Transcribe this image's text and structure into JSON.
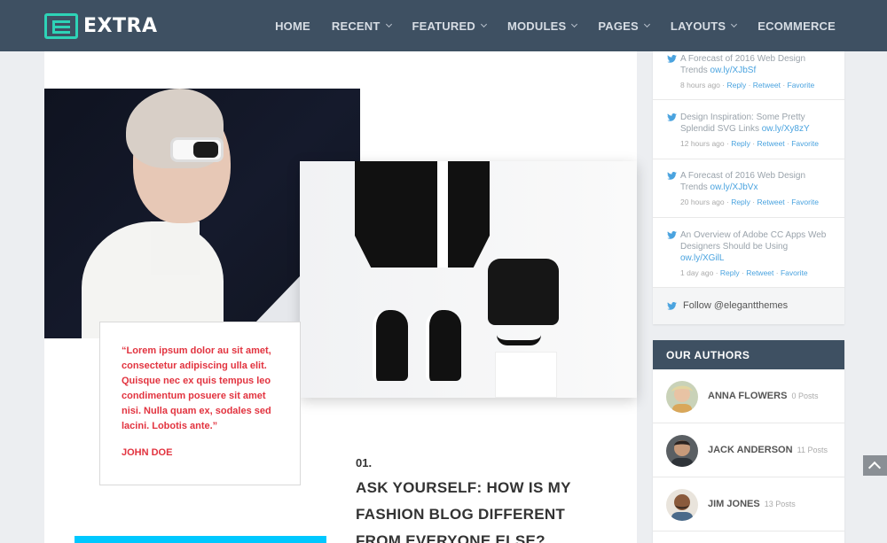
{
  "brand": {
    "name": "EXTRA",
    "accent": "#2ed3b7"
  },
  "nav": {
    "items": [
      {
        "label": "HOME",
        "dropdown": false
      },
      {
        "label": "RECENT",
        "dropdown": true
      },
      {
        "label": "FEATURED",
        "dropdown": true
      },
      {
        "label": "MODULES",
        "dropdown": true
      },
      {
        "label": "PAGES",
        "dropdown": true
      },
      {
        "label": "LAYOUTS",
        "dropdown": true
      },
      {
        "label": "ECOMMERCE",
        "dropdown": false
      }
    ]
  },
  "quote": {
    "text": "“Lorem ipsum dolor au sit amet, consectetur adipiscing ulla elit. Quisque nec ex quis tempus leo condimentum posuere sit amet nisi. Nulla quam ex, sodales sed lacini. Lobotis ante.”",
    "author": "JOHN DOE",
    "color": "#e2333f"
  },
  "post": {
    "number": "01.",
    "title": "ASK YOURSELF: HOW IS MY FASHION BLOG DIFFERENT FROM EVERYONE ELSE?"
  },
  "twitter": {
    "tweets": [
      {
        "text": "A Forecast of 2016 Web Design Trends",
        "link": "ow.ly/XJbSf",
        "time": "8 hours ago",
        "actions": [
          "Reply",
          "Retweet",
          "Favorite"
        ]
      },
      {
        "text": "Design Inspiration: Some Pretty Splendid SVG Links",
        "link": "ow.ly/Xy8zY",
        "time": "12 hours ago",
        "actions": [
          "Reply",
          "Retweet",
          "Favorite"
        ]
      },
      {
        "text": "A Forecast of 2016 Web Design Trends",
        "link": "ow.ly/XJbVx",
        "time": "20 hours ago",
        "actions": [
          "Reply",
          "Retweet",
          "Favorite"
        ]
      },
      {
        "text": "An Overview of Adobe CC Apps Web Designers Should be Using",
        "link": "ow.ly/XGilL",
        "time": "1 day ago",
        "actions": [
          "Reply",
          "Retweet",
          "Favorite"
        ]
      }
    ],
    "follow_label": "Follow @elegantthemes",
    "icon_color": "#4aa3df"
  },
  "authors": {
    "heading": "OUR AUTHORS",
    "list": [
      {
        "name": "ANNA FLOWERS",
        "posts": "0 Posts"
      },
      {
        "name": "JACK ANDERSON",
        "posts": "11 Posts"
      },
      {
        "name": "JIM JONES",
        "posts": "13 Posts"
      }
    ]
  },
  "icons": {
    "logo": "extra-logo-icon",
    "twitter": "twitter-bird-icon",
    "scroll_top": "chevron-up-icon"
  }
}
